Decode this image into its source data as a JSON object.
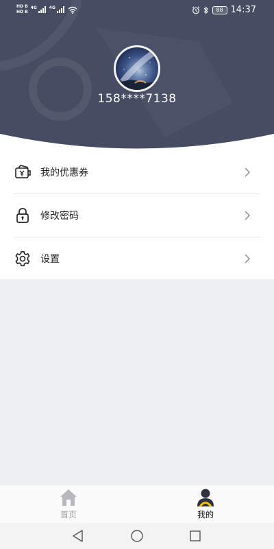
{
  "status_bar": {
    "sim_labels": [
      "HD B",
      "HD B"
    ],
    "network_labels": [
      "4G",
      "4G"
    ],
    "battery": "88",
    "time": "14:37"
  },
  "profile": {
    "phone": "158****7138"
  },
  "menu": {
    "items": [
      {
        "label": "我的优惠券",
        "icon": "coupon-icon"
      },
      {
        "label": "修改密码",
        "icon": "lock-icon"
      },
      {
        "label": "设置",
        "icon": "gear-icon"
      }
    ]
  },
  "bottom_nav": {
    "tabs": [
      {
        "label": "首页",
        "icon": "home-icon",
        "active": false
      },
      {
        "label": "我的",
        "icon": "user-icon",
        "active": true
      }
    ]
  },
  "colors": {
    "header_bg": "#464c62",
    "page_bg": "#eef0f4",
    "accent_yellow": "#f5c400",
    "inactive_gray": "#9b9b9b"
  }
}
